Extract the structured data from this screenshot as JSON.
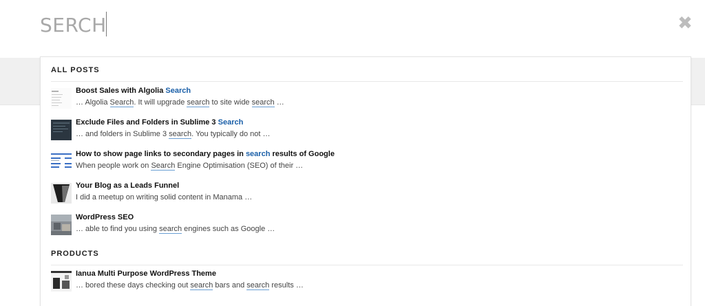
{
  "search": {
    "value": "SERCH",
    "close_icon": "close-icon"
  },
  "sections": [
    {
      "header": "ALL POSTS",
      "results": [
        {
          "title_parts": [
            {
              "text": "Boost Sales with Algolia "
            },
            {
              "text": "Search",
              "hl": true
            }
          ],
          "snippet_parts": [
            {
              "text": "… Algolia "
            },
            {
              "text": "Search",
              "ul": true
            },
            {
              "text": ". It will upgrade "
            },
            {
              "text": "search",
              "ul": true
            },
            {
              "text": " to site wide "
            },
            {
              "text": "search",
              "ul": true
            },
            {
              "text": " …"
            }
          ],
          "thumb": "doc-thumbnail"
        },
        {
          "title_parts": [
            {
              "text": "Exclude Files and Folders in Sublime 3 "
            },
            {
              "text": "Search",
              "hl": true
            }
          ],
          "snippet_parts": [
            {
              "text": "… and folders in Sublime 3 "
            },
            {
              "text": "search",
              "ul": true
            },
            {
              "text": ". You typically do not …"
            }
          ],
          "thumb": "editor-thumbnail"
        },
        {
          "title_parts": [
            {
              "text": "How to show page links to secondary pages in "
            },
            {
              "text": "search",
              "hl": true
            },
            {
              "text": " results of Google"
            }
          ],
          "snippet_parts": [
            {
              "text": "When people work on "
            },
            {
              "text": "Search",
              "ul": true
            },
            {
              "text": " Engine Optimisation (SEO) of their …"
            }
          ],
          "thumb": "serp-thumbnail"
        },
        {
          "title_parts": [
            {
              "text": "Your Blog as a Leads Funnel"
            }
          ],
          "snippet_parts": [
            {
              "text": "I did a meetup on writing solid content in Manama …"
            }
          ],
          "thumb": "funnel-thumbnail"
        },
        {
          "title_parts": [
            {
              "text": "WordPress SEO"
            }
          ],
          "snippet_parts": [
            {
              "text": "… able to find you using "
            },
            {
              "text": "search",
              "ul": true
            },
            {
              "text": " engines such as Google …"
            }
          ],
          "thumb": "photo-thumbnail"
        }
      ]
    },
    {
      "header": "PRODUCTS",
      "results": [
        {
          "title_parts": [
            {
              "text": "Ianua Multi Purpose WordPress Theme"
            }
          ],
          "snippet_parts": [
            {
              "text": "… bored these days checking out "
            },
            {
              "text": "search",
              "ul": true
            },
            {
              "text": " bars and "
            },
            {
              "text": "search",
              "ul": true
            },
            {
              "text": " results …"
            }
          ],
          "thumb": "theme-thumbnail"
        }
      ]
    }
  ],
  "colors": {
    "highlight": "#1a5fa8",
    "underline": "#6a9fd4"
  }
}
